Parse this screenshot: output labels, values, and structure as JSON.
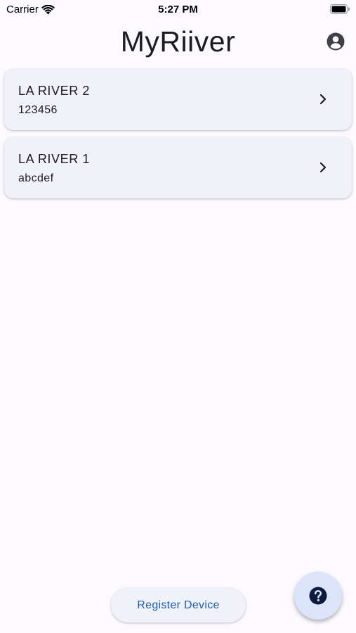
{
  "status_bar": {
    "carrier": "Carrier",
    "time": "5:27 PM"
  },
  "header": {
    "title": "MyRiiver",
    "profile_icon": "account-circle-icon"
  },
  "devices": [
    {
      "name": "LA RIVER 2",
      "code": "123456"
    },
    {
      "name": "LA RIVER 1",
      "code": "abcdef"
    }
  ],
  "actions": {
    "register_label": "Register Device",
    "help_icon": "help-circle-icon"
  },
  "colors": {
    "background": "#fcfaff",
    "card": "#f1f1f9",
    "accent_text": "#1a5fb4",
    "fab": "#dbe4f9",
    "icon_dark": "#3f3f46"
  }
}
